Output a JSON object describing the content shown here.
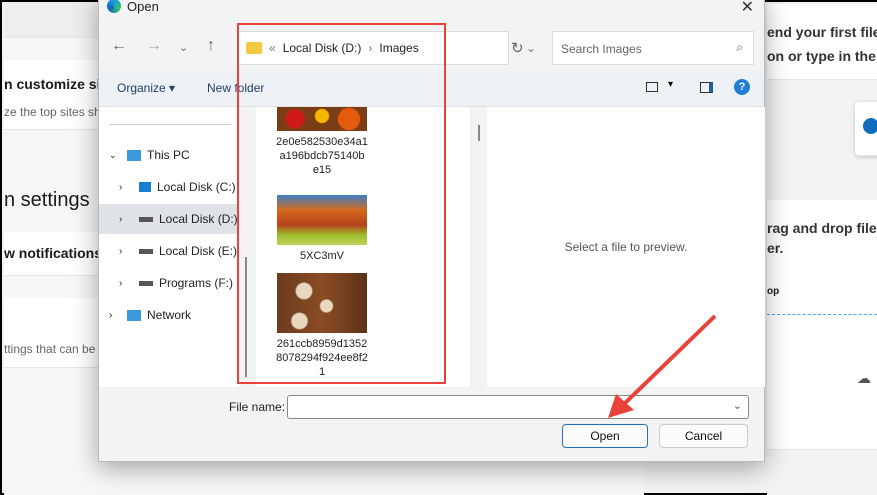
{
  "background": {
    "left_texts": [
      "n customize side",
      "ze the top sites sho",
      "n settings",
      "w notifications",
      "ttings that can be"
    ],
    "right_texts": [
      "end your first file",
      "on or type in the",
      "rag and drop file",
      "er.",
      "op"
    ]
  },
  "dialog": {
    "title": "Open",
    "close": "✕",
    "address": {
      "parts": [
        "«",
        "Local Disk (D:)",
        "›",
        "Images"
      ]
    },
    "search_placeholder": "Search Images",
    "toolbar": {
      "organize": "Organize",
      "new_folder": "New folder",
      "help": "?"
    },
    "tree": [
      {
        "label": "This PC"
      },
      {
        "label": "Local Disk (C:)"
      },
      {
        "label": "Local Disk (D:)",
        "selected": true
      },
      {
        "label": "Local Disk (E:)"
      },
      {
        "label": "Programs (F:)"
      },
      {
        "label": "Network"
      }
    ],
    "files": [
      {
        "name": "2e0e582530e34a1a196bdcb75140be15",
        "lines": [
          "2e0e582530e34a1",
          "a196bdcb75140b",
          "e15"
        ]
      },
      {
        "name": "5XC3mV",
        "lines": [
          "5XC3mV"
        ]
      },
      {
        "name": "261ccb8959d13528078294f924ee8f21",
        "lines": [
          "261ccb8959d1352",
          "8078294f924ee8f2",
          "1"
        ]
      }
    ],
    "preview_text": "Select a file to preview.",
    "filename_label": "File name:",
    "filename_value": "",
    "open": "Open",
    "cancel": "Cancel"
  },
  "colors": {
    "annotation": "#e8423a"
  }
}
